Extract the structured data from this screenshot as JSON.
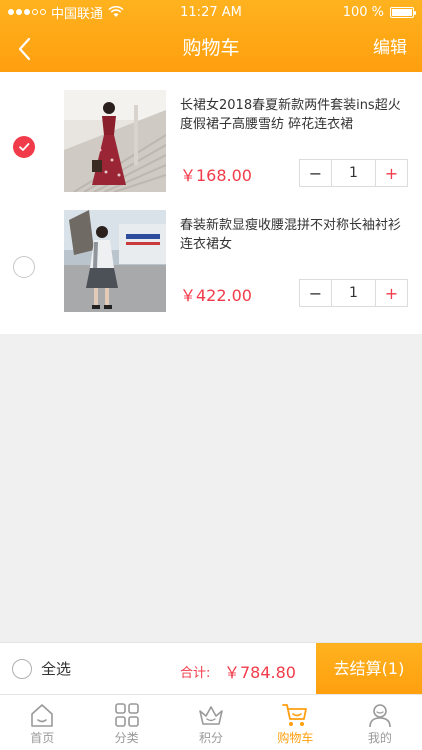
{
  "status_bar": {
    "carrier": "中国联通",
    "time": "11:27 AM",
    "battery_text": "100 %",
    "battery_level": 1.0
  },
  "header": {
    "title": "购物车",
    "edit_label": "编辑"
  },
  "cart": {
    "items": [
      {
        "title": "长裙女2018春夏新款两件套装ins超火度假裙子高腰雪纺 碎花连衣裙",
        "price": "￥168.00",
        "quantity": "1",
        "checked": true
      },
      {
        "title": "春装新款显瘦收腰混拼不对称长袖衬衫连衣裙女",
        "price": "￥422.00",
        "quantity": "1",
        "checked": false
      }
    ],
    "stepper": {
      "minus": "−",
      "plus": "+"
    }
  },
  "checkout": {
    "select_all_label": "全选",
    "total_label": "合计:",
    "total_value": "￥784.80",
    "button_label": "去结算(1)"
  },
  "tabs": [
    {
      "label": "首页",
      "icon": "home-icon",
      "active": false
    },
    {
      "label": "分类",
      "icon": "grid-icon",
      "active": false
    },
    {
      "label": "积分",
      "icon": "crown-icon",
      "active": false
    },
    {
      "label": "购物车",
      "icon": "cart-icon",
      "active": true
    },
    {
      "label": "我的",
      "icon": "user-icon",
      "active": false
    }
  ],
  "colors": {
    "accent": "#ff9f0e",
    "price": "#f23b4a"
  }
}
